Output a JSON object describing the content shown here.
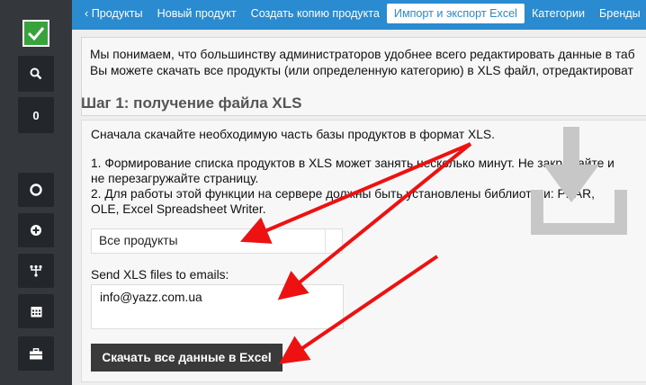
{
  "sidebar": {
    "search_icon": "search-icon",
    "count": "0",
    "items": [
      "lifebuoy-icon",
      "plus-circle-icon",
      "sitemap-icon",
      "calendar-icon",
      "briefcase-icon"
    ]
  },
  "tabs": [
    {
      "label": "‹ Продукты",
      "active": false
    },
    {
      "label": "Новый продукт",
      "active": false
    },
    {
      "label": "Создать копию продукта",
      "active": false
    },
    {
      "label": "Импорт и экспорт Excel",
      "active": true
    },
    {
      "label": "Категории",
      "active": false
    },
    {
      "label": "Бренды",
      "active": false
    }
  ],
  "info": {
    "line1": "Мы понимаем, что большинству администраторов удобнее всего редактировать данные в таб",
    "line2": "Вы можете скачать все продукты (или определенную категорию) в XLS файл, отредактироват"
  },
  "step": {
    "title": "Шаг 1: получение файла XLS",
    "intro": "Сначала скачайте необходимую часть базы продуктов в формат XLS.",
    "note1_line1": "1. Формирование списка продуктов в XLS может занять несколько минут. Не закрывайте и",
    "note1_line2": "не перезагружайте страницу.",
    "note2_line1": "2. Для работы этой функции на сервере должны быть установлены библиотеки: PEAR,",
    "note2_line2": "OLE, Excel Spreadsheet Writer.",
    "select_value": "Все продукты",
    "email_label": "Send XLS files to emails:",
    "email_value": "info@yazz.com.ua",
    "download_label": "Скачать все данные в Excel"
  },
  "colors": {
    "topbar": "#2a8bd0",
    "sidebar": "#34373c",
    "annotation_arrow": "#ee1111"
  }
}
